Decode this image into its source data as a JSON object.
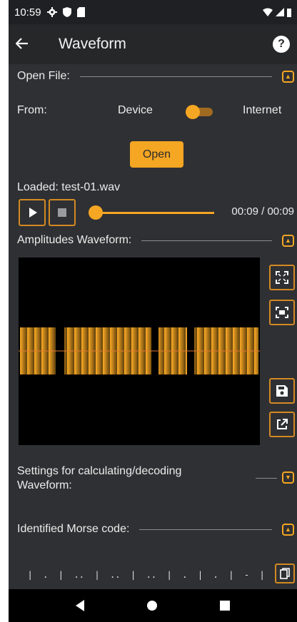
{
  "status": {
    "time": "10:59"
  },
  "appbar": {
    "title": "Waveform",
    "back_icon": "arrow-left-icon",
    "help_icon": "help-icon"
  },
  "open_file": {
    "header": "Open File:",
    "from_label": "From:",
    "option_device": "Device",
    "option_internet": "Internet",
    "source_internet_selected": false,
    "open_button": "Open",
    "loaded_text": "Loaded: test-01.wav"
  },
  "player": {
    "time_text": "00:09 / 00:09",
    "progress": 0.0
  },
  "waveform": {
    "header": "Amplitudes Waveform:",
    "colors": {
      "bars": "#f5a623",
      "background": "#000000",
      "center_line": "#e07830"
    }
  },
  "settings": {
    "header": "Settings for calculating/decoding Waveform:"
  },
  "morse": {
    "header": "Identified Morse code:",
    "lines": [
      "  |  .  |  ..  |  ..  |  ..  |  .  |  .  |  -  |",
      " ..  |  .  |  ...  |  .  |  -  |  .  |  ..  |  ..",
      "  |  ..  |  ...  |  -  |  .  |  .  |  -  |  ."
    ]
  }
}
